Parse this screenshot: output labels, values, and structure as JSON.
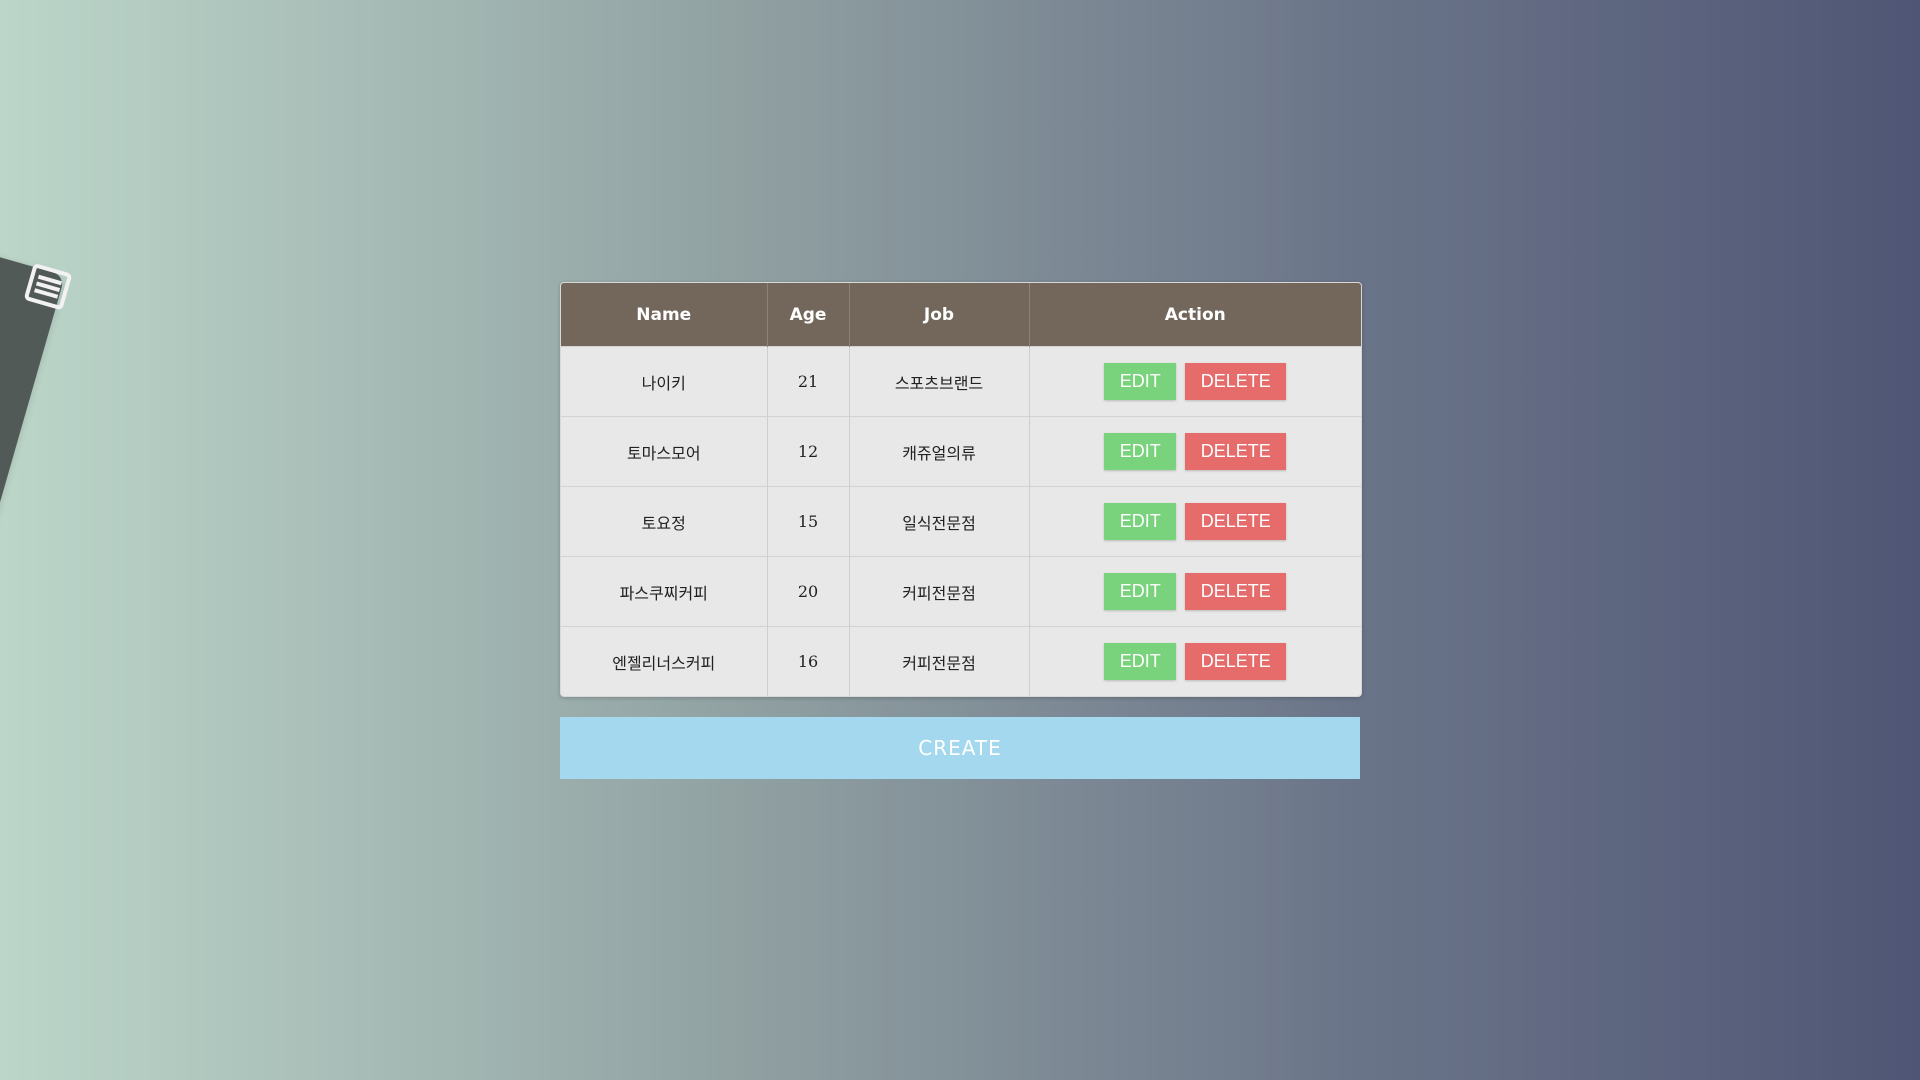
{
  "colors": {
    "header_bg": "#73675c",
    "edit": "#79d27c",
    "delete": "#e56c6b",
    "create": "#a3d8ee",
    "drawer": "#525a58"
  },
  "drawer": {
    "toggle_icon": "menu-lines-icon"
  },
  "table": {
    "headers": [
      "Name",
      "Age",
      "Job",
      "Action"
    ],
    "rows": [
      {
        "name": "나이키",
        "age": "21",
        "job": "스포츠브랜드"
      },
      {
        "name": "토마스모어",
        "age": "12",
        "job": "캐쥬얼의류"
      },
      {
        "name": "토요정",
        "age": "15",
        "job": "일식전문점"
      },
      {
        "name": "파스쿠찌커피",
        "age": "20",
        "job": "커피전문점"
      },
      {
        "name": "엔젤리너스커피",
        "age": "16",
        "job": "커피전문점"
      }
    ],
    "edit_label": "EDIT",
    "delete_label": "DELETE"
  },
  "create_label": "CREATE"
}
